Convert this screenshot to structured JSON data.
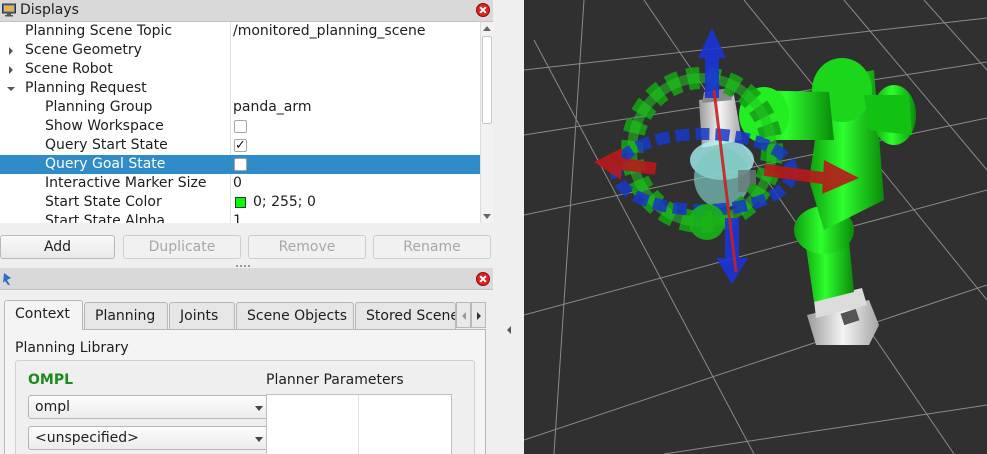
{
  "displays": {
    "title": "Displays",
    "rows": [
      {
        "name": "Planning Scene Topic",
        "value": "/monitored_planning_scene"
      },
      {
        "name": "Scene Geometry",
        "value": ""
      },
      {
        "name": "Scene Robot",
        "value": ""
      },
      {
        "name": "Planning Request",
        "value": ""
      },
      {
        "name": "Planning Group",
        "value": "panda_arm"
      },
      {
        "name": "Show Workspace",
        "value": ""
      },
      {
        "name": "Query Start State",
        "value": ""
      },
      {
        "name": "Query Goal State",
        "value": ""
      },
      {
        "name": "Interactive Marker Size",
        "value": "0"
      },
      {
        "name": "Start State Color",
        "value": "0; 255; 0"
      },
      {
        "name": "Start State Alpha",
        "value": "1"
      }
    ],
    "checkboxes": {
      "show_workspace": false,
      "query_start_state": true,
      "query_goal_state": false
    },
    "selected_row": "Query Goal State",
    "start_state_color": "#00ff00",
    "buttons": {
      "add": "Add",
      "duplicate": "Duplicate",
      "remove": "Remove",
      "rename": "Rename"
    }
  },
  "motion_planning": {
    "tabs": [
      "Context",
      "Planning",
      "Joints",
      "Scene Objects",
      "Stored Scene"
    ],
    "active_tab": "Context",
    "planning_library_label": "Planning Library",
    "library_name": "OMPL",
    "planner_parameters_label": "Planner Parameters",
    "library_select": "ompl",
    "planner_select": "<unspecified>"
  },
  "colors": {
    "selection": "#308cc6",
    "robot_link": "#00ff00",
    "viewport_bg": "#303030",
    "ompl_green": "#1c8a1c"
  },
  "icons": [
    "monitor-icon",
    "close-icon",
    "plugin-icon",
    "chevron-down-icon",
    "chevron-left-icon"
  ]
}
